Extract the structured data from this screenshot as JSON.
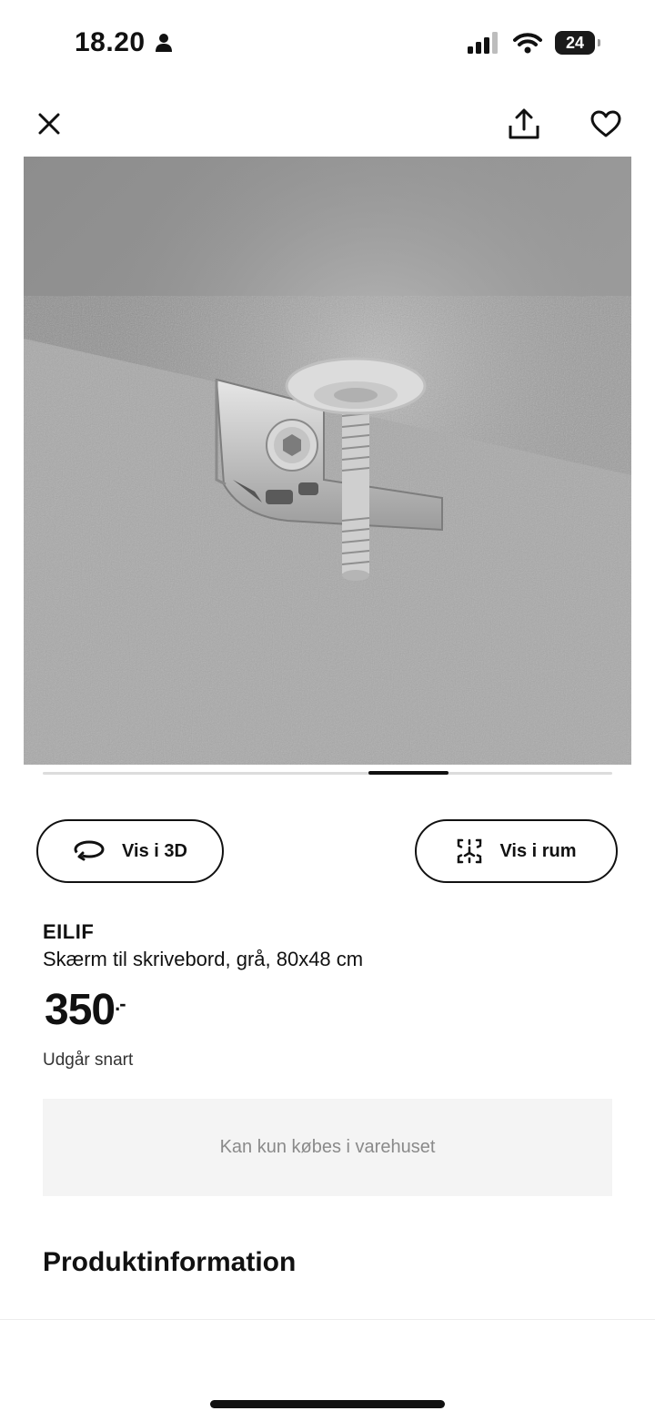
{
  "status_bar": {
    "time": "18.20",
    "battery": "24"
  },
  "top_bar": {
    "close_icon": "close-icon",
    "share_icon": "share-icon",
    "favorite_icon": "heart-icon"
  },
  "gallery": {
    "active_slide_fraction_start": 0.57,
    "active_slide_fraction_width": 0.14
  },
  "actions": {
    "view_3d_label": "Vis i 3D",
    "view_in_room_label": "Vis i rum"
  },
  "product": {
    "name": "EILIF",
    "description": "Skærm til skrivebord, grå, 80x48 cm",
    "price": "350",
    "price_suffix": ".-",
    "availability_note": "Udgår snart",
    "store_only_label": "Kan kun købes i varehuset"
  },
  "sections": {
    "product_info_title": "Produktinformation"
  }
}
